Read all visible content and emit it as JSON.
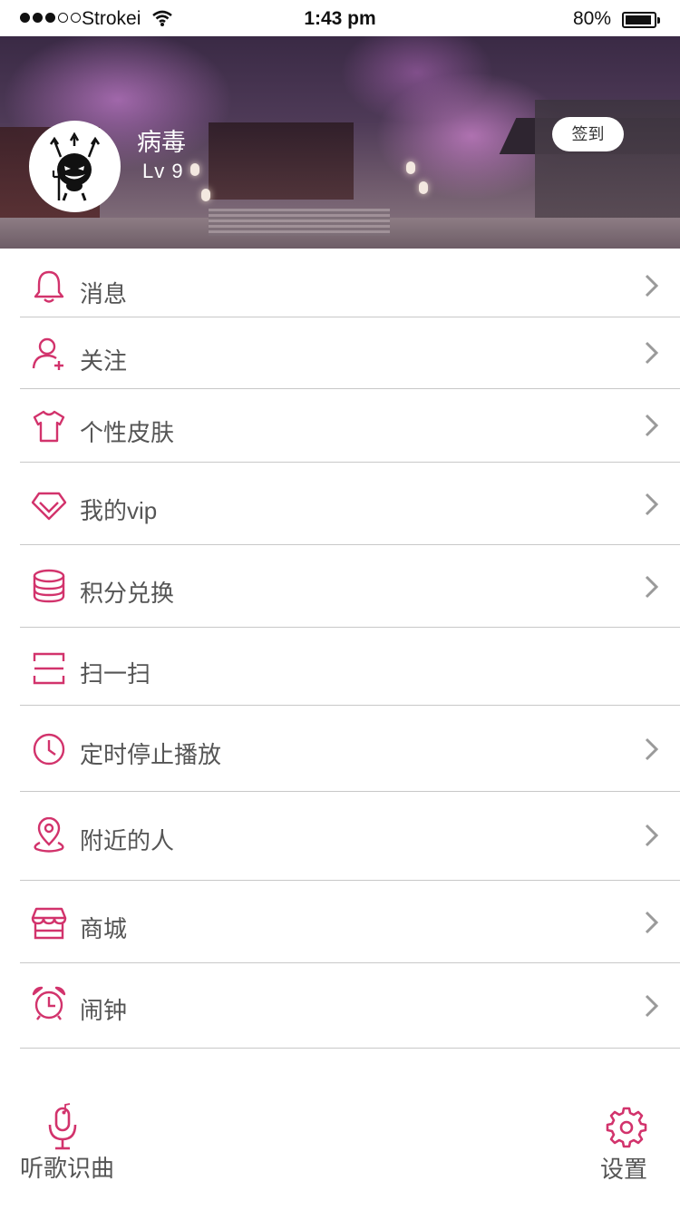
{
  "status_bar": {
    "carrier": "Strokei",
    "time": "1:43 pm",
    "battery": "80%",
    "battery_level": 0.8,
    "signal_bars_filled": 3,
    "signal_bars_total": 5
  },
  "profile": {
    "username": "病毒",
    "level": "Lv 9",
    "checkin_label": "签到",
    "avatar_icon": "devil-avatar-icon"
  },
  "menu": {
    "items": [
      {
        "label": "消息",
        "icon": "bell-icon",
        "has_chevron": true
      },
      {
        "label": "关注",
        "icon": "user-add-icon",
        "has_chevron": true
      },
      {
        "label": "个性皮肤",
        "icon": "tshirt-icon",
        "has_chevron": true
      },
      {
        "label": "我的vip",
        "icon": "diamond-icon",
        "has_chevron": true
      },
      {
        "label": "积分兑换",
        "icon": "coins-icon",
        "has_chevron": true
      },
      {
        "label": "扫一扫",
        "icon": "scan-icon",
        "has_chevron": false
      },
      {
        "label": "定时停止播放",
        "icon": "clock-icon",
        "has_chevron": true
      },
      {
        "label": "附近的人",
        "icon": "location-pin-icon",
        "has_chevron": true
      },
      {
        "label": "商城",
        "icon": "store-icon",
        "has_chevron": true
      },
      {
        "label": "闹钟",
        "icon": "alarm-clock-icon",
        "has_chevron": true
      }
    ]
  },
  "bottom": {
    "recognize_label": "听歌识曲",
    "settings_label": "设置"
  },
  "colors": {
    "accent": "#d2336c",
    "chevron": "#9a9a9a",
    "divider": "#c8c8c8",
    "text": "#555555"
  }
}
